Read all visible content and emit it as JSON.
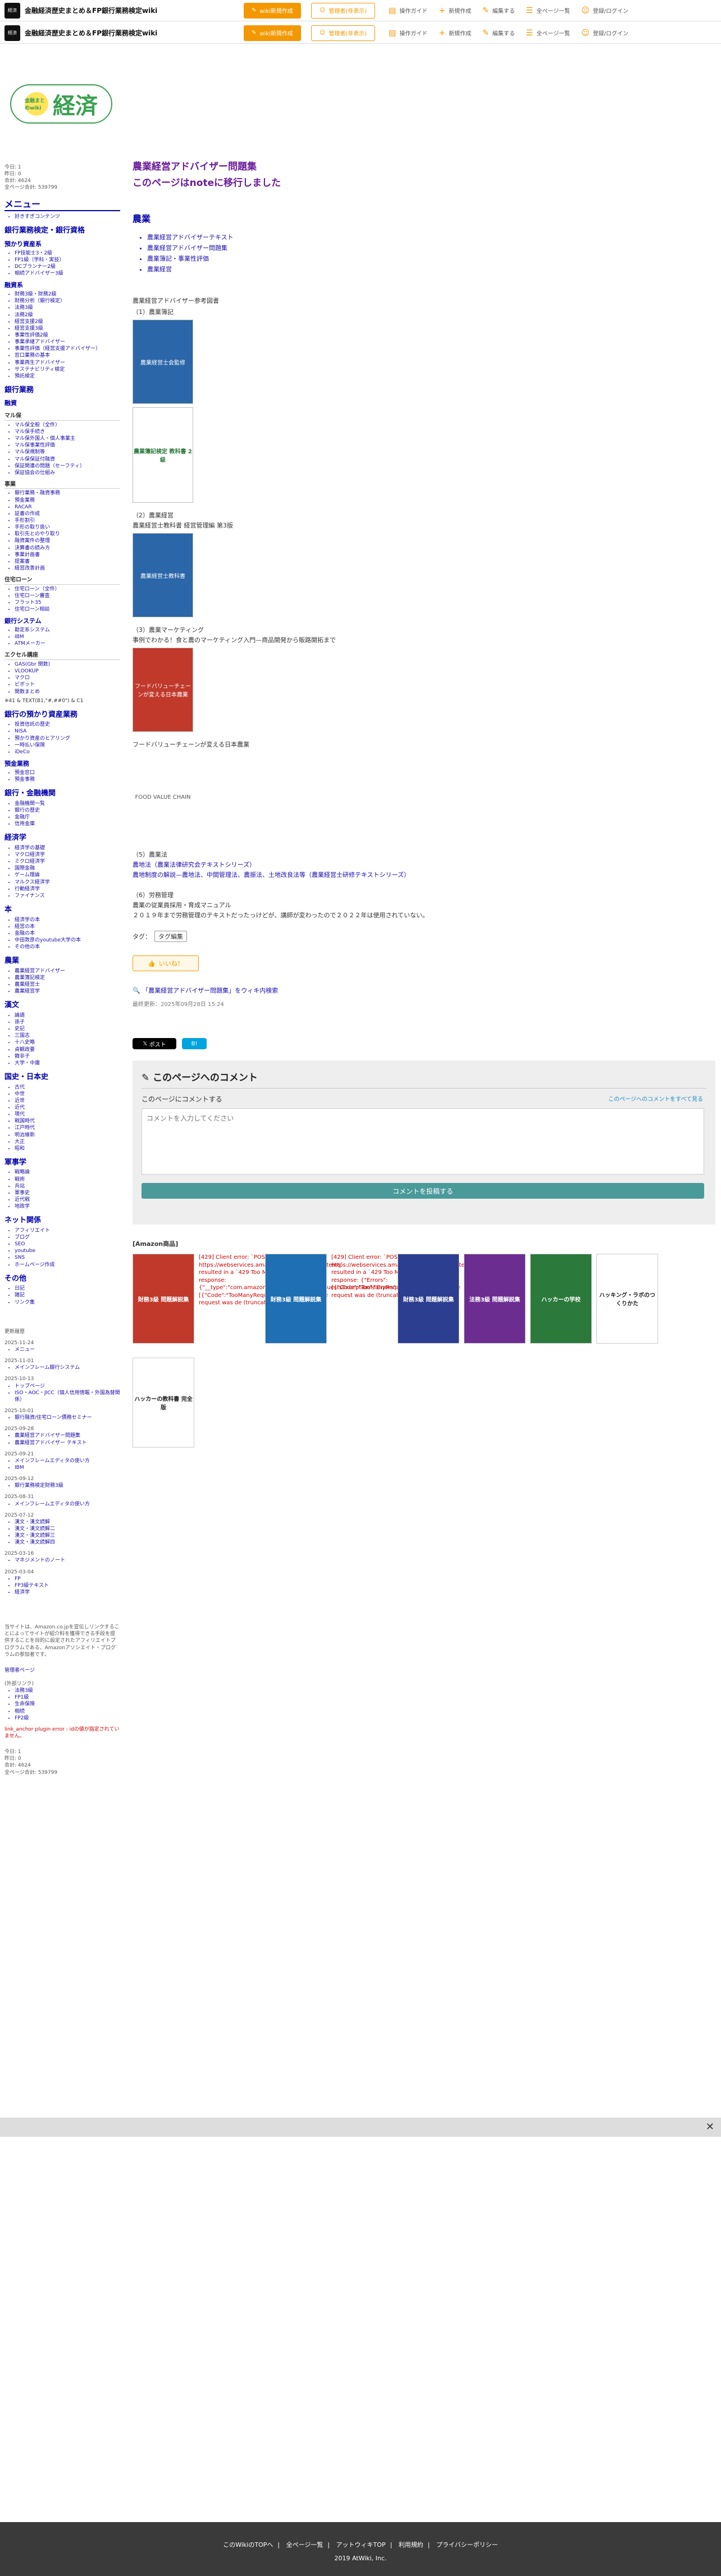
{
  "topbar": {
    "logo_text": "経済",
    "title": "金融経済歴史まとめ＆FP銀行業務検定wiki",
    "btn_main": "wiki新規作成",
    "btn_sub": "管理者(非表示)",
    "menu": [
      "操作ガイド",
      "新規作成",
      "編集する",
      "全ページ一覧",
      "登録/ログイン"
    ]
  },
  "logo": {
    "small": "金融まとめwiki",
    "big": "経済"
  },
  "sidebar": {
    "meta": [
      "今日: 1",
      "昨日: 0",
      "合計: 4624",
      "全ページ合計: 539799"
    ],
    "menu_h": "メニュー",
    "menu_first": "好きすぎコンテンツ",
    "h_bank": "銀行業務検定・銀行資格",
    "h_fp": "預かり資産系",
    "fp_items": [
      "FP技能士3・2級",
      "FP1級（学科・実技）",
      "DCプランナー2級",
      "相続アドバイザー3級"
    ],
    "h_finance": "融資系",
    "finance_items": [
      "財務3級・財務2級",
      "財務分析（銀行検定）",
      "法務3級",
      "法務2級",
      "経営支援2級",
      "経営支援3級",
      "事業性評価2級",
      "事業承継アドバイザー",
      "事業性評価（経営支援アドバイザー）",
      "窓口業務の基本",
      "事業再生アドバイザー",
      "サステナビリティ検定",
      "預託検定"
    ],
    "h_bankwork": "銀行業務",
    "h_loan": "融資",
    "h_maru": "マル保",
    "maru_items": [
      "マル保全般（全件）",
      "マル保手続き",
      "マル保外国人・個人事業主",
      "マル保事業性評価",
      "マル保規制等",
      "マル保保証付融資",
      "保証関連の問題（セーフティ）",
      "保証協会の仕組み"
    ],
    "h_bizloan": "事業",
    "bizloan_items": [
      "銀行業務・融資事務",
      "預金業務",
      "RACAR",
      "証書の作成",
      "手形割引",
      "手形の取り扱い",
      "取引先とのやり取り",
      "融資案件の整理",
      "決算書の読み方",
      "事業計画書",
      "提案書",
      "経営改善計画"
    ],
    "h_home": "住宅ローン",
    "home_items": [
      "住宅ローン（全件）",
      "住宅ローン審査",
      "フラット35",
      "住宅ローン相談"
    ],
    "h_system": "銀行システム",
    "system_items": [
      "勘定系システム",
      "IBM",
      "ATMメーカー"
    ],
    "h_excel": "エクセル講座",
    "excel_items": [
      "GAS(Gbr 関数)",
      "VLOOKUP",
      "マクロ",
      "ピボット",
      "関数まとめ"
    ],
    "excel_note": "※41 & TEXT(B1,\"#,##0\") & C1",
    "h_asset": "銀行の預かり資産業務",
    "asset_items": [
      "投資信託の歴史",
      "NISA",
      "預かり資産のヒアリング",
      "一時払い保険",
      "iDeCo"
    ],
    "h_deposit": "預金業務",
    "deposit_items": [
      "預金窓口",
      "預金事務"
    ],
    "h_org": "銀行・金融機関",
    "org_items": [
      "金融機関一覧",
      "銀行の歴史",
      "金融庁",
      "信用金庫"
    ],
    "h_econ": "経済学",
    "econ_items": [
      "経済学の基礎",
      "マクロ経済学",
      "ミクロ経済学",
      "国際金融",
      "ゲーム理論",
      "マルクス経済学",
      "行動経済学",
      "ファイナンス"
    ],
    "h_book": "本",
    "book_items": [
      "経済学の本",
      "経営の本",
      "金融の本",
      "中田敦彦のyoutube大学の本",
      "その他の本"
    ],
    "h_agri": "農業",
    "agri_items": [
      "農業経営アドバイザー",
      "農業簿記検定",
      "農業経営士",
      "農業経営学"
    ],
    "h_kanji": "漢文",
    "kanji_items": [
      "論語",
      "孫子",
      "史記",
      "三国志",
      "十八史略",
      "貞観政要",
      "韓非子",
      "大学・中庸"
    ],
    "h_history": "国史・日本史",
    "history_items": [
      "古代",
      "中世",
      "近世",
      "近代",
      "現代",
      "戦国時代",
      "江戸時代",
      "明治維新",
      "大正",
      "昭和"
    ],
    "h_army": "軍事学",
    "army_items": [
      "戦略論",
      "戦術",
      "兵站",
      "軍事史",
      "近代戦",
      "地政学"
    ],
    "h_net": "ネット関係",
    "net_items": [
      "アフィリエイト",
      "ブログ",
      "SEO",
      "youtube",
      "SNS",
      "ホームページ作成"
    ],
    "h_other": "その他",
    "other_items": [
      "日記",
      "雑記",
      "リンク集"
    ],
    "history_title": "更新履歴",
    "history": [
      {
        "date": "2025-11-24",
        "items": [
          "メニュー"
        ]
      },
      {
        "date": "2025-11-01",
        "items": [
          "メインフレーム銀行システム"
        ]
      },
      {
        "date": "2025-10-13",
        "items": [
          "トップページ",
          "ISO・AOC・JICC（個人信用情報・外国為替関係）"
        ]
      },
      {
        "date": "2025-10-01",
        "items": [
          "銀行融資/住宅ローン債務セミナー"
        ]
      },
      {
        "date": "2025-09-28",
        "items": [
          "農業経営アドバイザー問題集",
          "農業経営アドバイザー テキスト"
        ]
      },
      {
        "date": "2025-09-21",
        "items": [
          "メインフレームエディタの使い方",
          "IBM"
        ]
      },
      {
        "date": "2025-09-12",
        "items": [
          "銀行業務検定財務3級"
        ]
      },
      {
        "date": "2025-08-31",
        "items": [
          "メインフレームエディタの使い方"
        ]
      },
      {
        "date": "2025-07-12",
        "items": [
          "漢文・漢文読解",
          "漢文・漢文読解二",
          "漢文・漢文読解三",
          "漢文・漢文読解四"
        ]
      },
      {
        "date": "2025-03-16",
        "items": [
          "マネジメントのノート"
        ]
      },
      {
        "date": "2025-03-04",
        "items": [
          "FP",
          "FP3級テキスト",
          "経済学"
        ]
      }
    ],
    "amazon_note": "当サイトは、Amazon.co.jpを宣伝しリンクすることによってサイトが紹介料を獲得できる手段を提供することを目的に設定されたアフィリエイトプログラムである、Amazonアソシエイト・プログラムの参加者です。",
    "admin_title": "管理者ページ",
    "search_h": "(外部リンク)",
    "search_items": [
      "法務3級",
      "FP1級",
      "生命保険",
      "相続",
      "FP2級"
    ],
    "footnote": "link_anchor plugin error : idの値が指定されていません。",
    "footer_meta": [
      "今日: 1",
      "昨日: 0",
      "合計: 4624",
      "全ページ合計: 539799"
    ]
  },
  "main": {
    "title1": "農業経営アドバイザー問題集",
    "title2": "このページはnoteに移行しました",
    "sec_h": "農業",
    "toc": [
      "農業経営アドバイザーテキスト",
      "農業経営アドバイザー問題集",
      "農業簿記・事業性評価",
      "農業経営"
    ],
    "intro": "農業経営アドバイザー参考図書",
    "s1": "（1）農業簿記",
    "book1_label": "農業経営士会監修",
    "book2_label": "農業簿記検定 教科書 2級",
    "s2": "（2）農業経営",
    "s2_desc": "農業経営士教科書 経営管理編 第3版",
    "book3_label": "農業経営士教科書",
    "s3": "（3）農業マーケティング",
    "s3_desc": "事例でわかる！食と農のマーケティング入門—商品開発から販路開拓まで",
    "book4_label": "フードバリューチェーンが変える日本農業",
    "s3_desc2": "フードバリューチェーンが変える日本農業",
    "book5_label": "FOOD VALUE CHAIN",
    "s5": "（5）農業法",
    "s5_desc": "農地法（農業法律研究会テキストシリーズ）",
    "s5_desc2": "農地制度の解説—農地法、中間管理法、農振法、土地改良法等（農業経営士研修テキストシリーズ）",
    "s6": "（6）労務管理",
    "s6_desc": "農業の従業員採用・育成マニュアル",
    "s6_desc2": "２０１９年まで労務管理のテキストだったっけどが、講師が変わったので２０２２年は使用されていない。",
    "tag_label": "タグ：",
    "tag": "タグ編集",
    "iine": "いいね！",
    "search_link": "「農業経営アドバイザー問題集」をウィキ内検索",
    "updated": "最終更新：2025年09月28日 15:24",
    "post": "ポスト",
    "b": "B!",
    "comment_h": "このページへのコメント",
    "comment_all": "このページへのコメントをすべて見る",
    "comment_lbl": "このページにコメントする",
    "comment_placeholder": "コメントを入力してください",
    "comment_post": "コメントを投稿する",
    "amz_title": "[Amazon商品]",
    "amz_err1": "[429] Client error: `POST https://webservices.amazon.co.jp/paapi5/getitems` resulted in a `429 Too Many Requests` response: {\"__type\":\"com.amazon.paapi5#TooManyRequestsException\",\"Errors\":[{\"Code\":\"TooManyRequests\",\"Message\":\"The request was de (truncated...)",
    "amz_err2": "[429] Client error: `POST https://webservices.amazon.co.jp/paapi5/getitems` resulted in a `429 Too Many Requests` response: {\"Errors\":[{\"Code\":\"TooManyRequests\",\"Message\":\"The request was de (truncated...)",
    "amz_books": [
      "財務3級 問題解説集",
      "財務3級 問題解説集",
      "財務3級 問題解説集",
      "法務3級 問題解説集",
      "ハッカーの学校",
      "ハッキング・ラボのつくりかた",
      "ハッカーの教科書 完全版"
    ],
    "amz_book_colors": [
      "#c0392b",
      "#1e6fb3",
      "#2c3e8f",
      "#6c2d91",
      "#2b7a3b",
      "#ffffff",
      "#111111",
      "#ffffff"
    ]
  },
  "footer": {
    "links": [
      "このWikiのTOPへ",
      "全ページ一覧",
      "アットウィキTOP",
      "利用規約",
      "プライバシーポリシー"
    ],
    "copy": "2019 AtWiki, Inc."
  }
}
